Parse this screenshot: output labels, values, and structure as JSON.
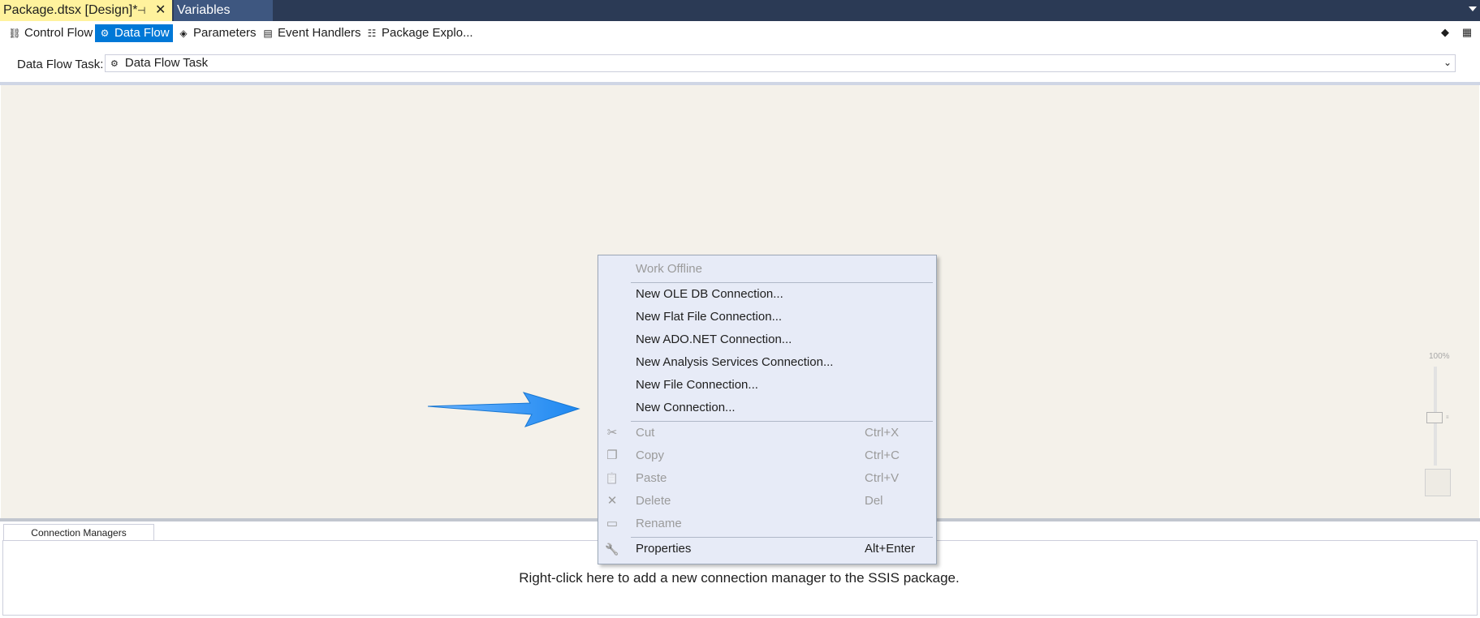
{
  "document_tabs": {
    "active": {
      "title": "Package.dtsx [Design]*",
      "pin_glyph": "⊣",
      "close_glyph": "✕"
    },
    "inactive": {
      "title": "Variables"
    }
  },
  "designer_tabs": [
    {
      "label": "Control Flow",
      "icon": "control-flow-icon",
      "glyph": "⛓"
    },
    {
      "label": "Data Flow",
      "icon": "data-flow-icon",
      "glyph": "⚙"
    },
    {
      "label": "Parameters",
      "icon": "parameters-icon",
      "glyph": "◈"
    },
    {
      "label": "Event Handlers",
      "icon": "event-handlers-icon",
      "glyph": "▤"
    },
    {
      "label": "Package Explo...",
      "icon": "package-explorer-icon",
      "glyph": "☷"
    }
  ],
  "toolbar_right": {
    "icon_a": "◆",
    "icon_b": "▦"
  },
  "task": {
    "label": "Data Flow Task:",
    "value": "Data Flow Task",
    "icon": "⚙"
  },
  "zoom": {
    "label": "100%",
    "level_percent": 100
  },
  "context_menu": {
    "items": [
      {
        "label": "Work Offline",
        "shortcut": "",
        "enabled": false,
        "icon": ""
      },
      {
        "label": "New OLE DB Connection...",
        "shortcut": "",
        "enabled": true,
        "icon": ""
      },
      {
        "label": "New Flat File Connection...",
        "shortcut": "",
        "enabled": true,
        "icon": ""
      },
      {
        "label": "New ADO.NET Connection...",
        "shortcut": "",
        "enabled": true,
        "icon": ""
      },
      {
        "label": "New Analysis Services Connection...",
        "shortcut": "",
        "enabled": true,
        "icon": ""
      },
      {
        "label": "New File Connection...",
        "shortcut": "",
        "enabled": true,
        "icon": ""
      },
      {
        "label": "New Connection...",
        "shortcut": "",
        "enabled": true,
        "icon": ""
      },
      {
        "label": "Cut",
        "shortcut": "Ctrl+X",
        "enabled": false,
        "icon": "✂"
      },
      {
        "label": "Copy",
        "shortcut": "Ctrl+C",
        "enabled": false,
        "icon": "❐"
      },
      {
        "label": "Paste",
        "shortcut": "Ctrl+V",
        "enabled": false,
        "icon": "📋"
      },
      {
        "label": "Delete",
        "shortcut": "Del",
        "enabled": false,
        "icon": "✕"
      },
      {
        "label": "Rename",
        "shortcut": "",
        "enabled": false,
        "icon": "▭"
      },
      {
        "label": "Properties",
        "shortcut": "Alt+Enter",
        "enabled": true,
        "icon": "🔧"
      }
    ]
  },
  "connection_managers": {
    "tab_label": "Connection Managers",
    "hint": "Right-click here to add a new connection manager to the SSIS package."
  },
  "colors": {
    "accent": "#0078d7",
    "arrow": "#1e90ff",
    "active_tab": "#fff29d",
    "tab_strip": "#2b3a55"
  }
}
